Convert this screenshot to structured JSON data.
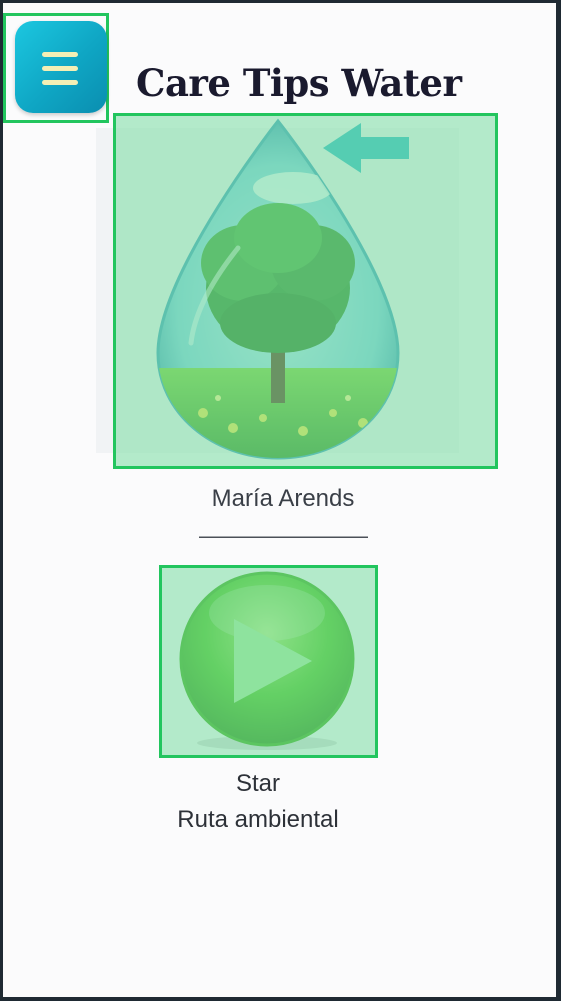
{
  "header": {
    "title": "Care Tips Water",
    "menu_icon": "hamburger-menu-icon"
  },
  "hero": {
    "image_icon": "water-drop-tree-icon",
    "arrow_icon": "arrow-left-icon",
    "author": "María Arends",
    "separator": "————————"
  },
  "player": {
    "icon": "play-icon",
    "label": "Star",
    "sublabel": "Ruta ambiental"
  },
  "colors": {
    "menu_button": "#12b5d3",
    "menu_lines": "#f4efb5",
    "highlight_border": "#22c55e",
    "play_green": "#4cc21d",
    "arrow": "#2bbac7"
  }
}
